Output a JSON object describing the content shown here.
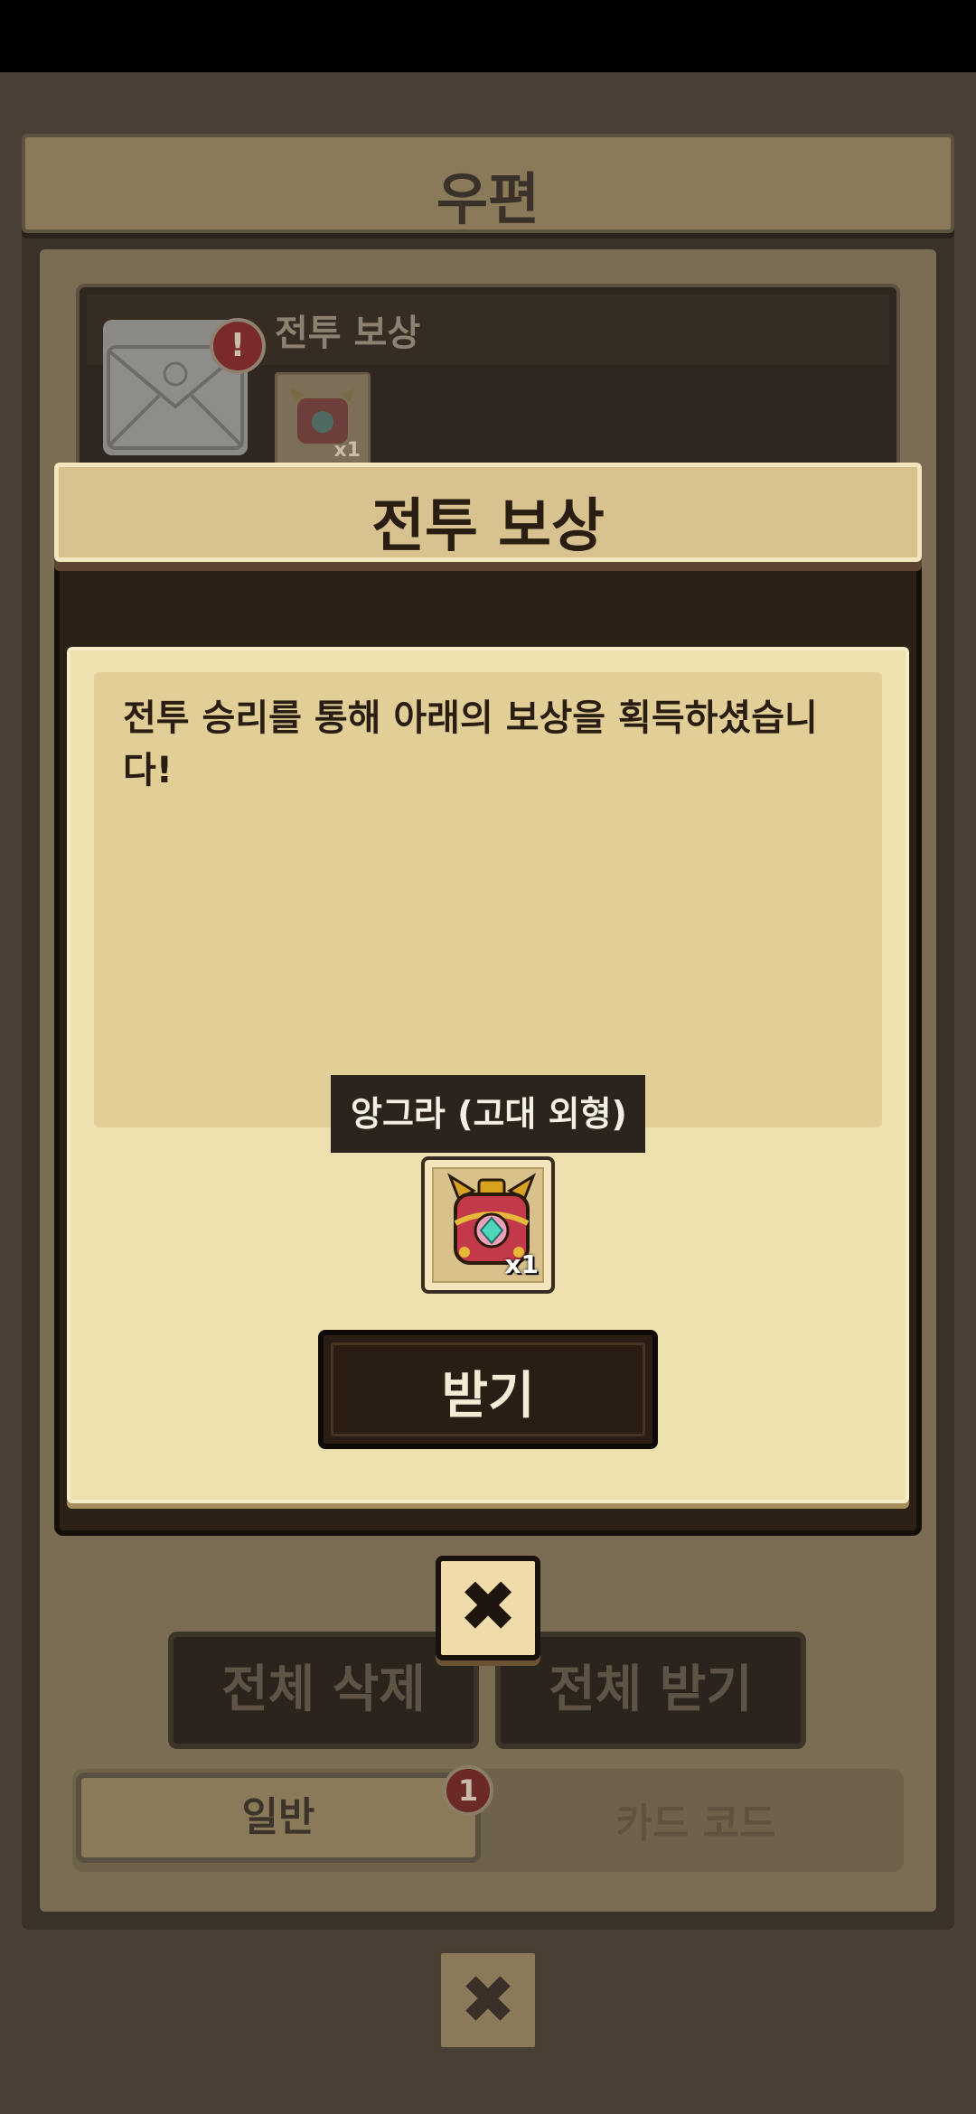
{
  "mailbox": {
    "title": "우편",
    "mail_item": {
      "title": "전투 보상",
      "alert_badge": "!",
      "item_qty": "x1"
    },
    "delete_all_label": "전체 삭제",
    "receive_all_label": "전체 받기",
    "tabs": [
      {
        "label": "일반",
        "badge": "1"
      },
      {
        "label": "카드 코드"
      }
    ],
    "close_icon": "✖"
  },
  "dialog": {
    "title": "전투 보상",
    "message": "전투 승리를 통해 아래의 보상을 획득하셨습니다!",
    "reward": {
      "name": "앙그라 (고대 외형)",
      "qty": "x1",
      "icon": "ornate-chest-icon"
    },
    "receive_label": "받기",
    "close_icon": "✖"
  }
}
